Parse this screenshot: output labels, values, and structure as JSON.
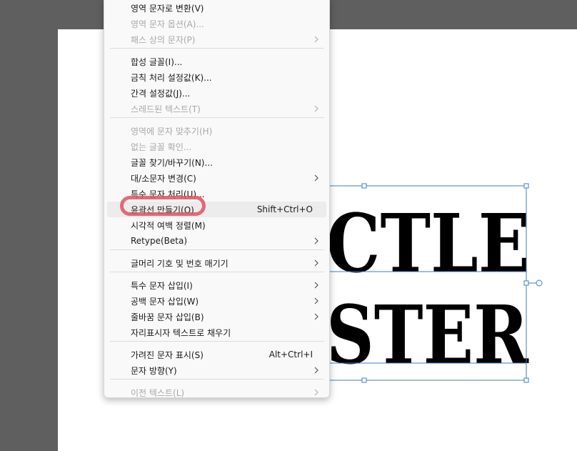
{
  "canvas": {
    "line1": "CTLE",
    "line2": "STER"
  },
  "menu": {
    "items": [
      {
        "label": "영역 문자로 변환(V)",
        "shortcut": "",
        "submenu": false,
        "disabled": false
      },
      {
        "label": "영역 문자 옵션(A)...",
        "shortcut": "",
        "submenu": false,
        "disabled": true
      },
      {
        "label": "패스 상의 문자(P)",
        "shortcut": "",
        "submenu": true,
        "disabled": true
      },
      {
        "label": "합성 글꼴(I)...",
        "shortcut": "",
        "submenu": false,
        "disabled": false
      },
      {
        "label": "금칙 처리 설정값(K)...",
        "shortcut": "",
        "submenu": false,
        "disabled": false
      },
      {
        "label": "간격 설정값(J)...",
        "shortcut": "",
        "submenu": false,
        "disabled": false
      },
      {
        "label": "스레드된 텍스트(T)",
        "shortcut": "",
        "submenu": true,
        "disabled": true
      },
      {
        "label": "영역에 문자 맞추기(H)",
        "shortcut": "",
        "submenu": false,
        "disabled": true
      },
      {
        "label": "없는 글꼴 확인...",
        "shortcut": "",
        "submenu": false,
        "disabled": true
      },
      {
        "label": "글꼴 찾기/바꾸기(N)...",
        "shortcut": "",
        "submenu": false,
        "disabled": false
      },
      {
        "label": "대/소문자 변경(C)",
        "shortcut": "",
        "submenu": true,
        "disabled": false
      },
      {
        "label": "특수 문자 처리(U)...",
        "shortcut": "",
        "submenu": false,
        "disabled": false
      },
      {
        "label": "윤곽선 만들기(O)",
        "shortcut": "Shift+Ctrl+O",
        "submenu": false,
        "disabled": false,
        "highlighted": true
      },
      {
        "label": "시각적 여백 정렬(M)",
        "shortcut": "",
        "submenu": false,
        "disabled": false
      },
      {
        "label": "Retype(Beta)",
        "shortcut": "",
        "submenu": true,
        "disabled": false
      },
      {
        "label": "글머리 기호 및 번호 매기기",
        "shortcut": "",
        "submenu": true,
        "disabled": false
      },
      {
        "label": "특수 문자 삽입(I)",
        "shortcut": "",
        "submenu": true,
        "disabled": false
      },
      {
        "label": "공백 문자 삽입(W)",
        "shortcut": "",
        "submenu": true,
        "disabled": false
      },
      {
        "label": "줄바꿈 문자 삽입(B)",
        "shortcut": "",
        "submenu": true,
        "disabled": false
      },
      {
        "label": "자리표시자 텍스트로 채우기",
        "shortcut": "",
        "submenu": false,
        "disabled": false
      },
      {
        "label": "가려진 문자 표시(S)",
        "shortcut": "Alt+Ctrl+I",
        "submenu": false,
        "disabled": false
      },
      {
        "label": "문자 방향(Y)",
        "shortcut": "",
        "submenu": true,
        "disabled": false
      },
      {
        "label": "이전 텍스트(L)",
        "shortcut": "",
        "submenu": true,
        "disabled": true
      }
    ]
  }
}
